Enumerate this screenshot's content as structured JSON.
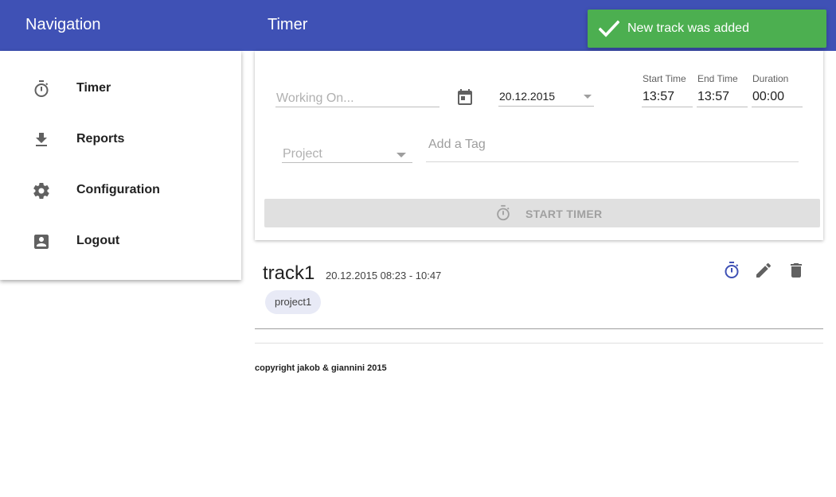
{
  "header": {
    "nav_title": "Navigation",
    "page_title": "Timer",
    "bg_color": "#3f51b5"
  },
  "toast": {
    "message": "New track was added",
    "icon": "check-icon",
    "color": "#4caf50"
  },
  "sidebar": {
    "items": [
      {
        "label": "Timer",
        "icon": "stopwatch-icon"
      },
      {
        "label": "Reports",
        "icon": "download-icon"
      },
      {
        "label": "Configuration",
        "icon": "gear-icon"
      },
      {
        "label": "Logout",
        "icon": "account-box-icon"
      }
    ]
  },
  "form": {
    "working_on_placeholder": "Working On...",
    "date_value": "20.12.2015",
    "start_time_label": "Start Time",
    "start_time_value": "13:57",
    "end_time_label": "End Time",
    "end_time_value": "13:57",
    "duration_label": "Duration",
    "duration_value": "00:00",
    "project_placeholder": "Project",
    "tag_placeholder": "Add a Tag",
    "start_button_label": "START TIMER"
  },
  "tracks": [
    {
      "name": "track1",
      "time": "20.12.2015 08:23 - 10:47",
      "project": "project1"
    }
  ],
  "footer": {
    "copyright": "copyright jakob & giannini 2015"
  }
}
